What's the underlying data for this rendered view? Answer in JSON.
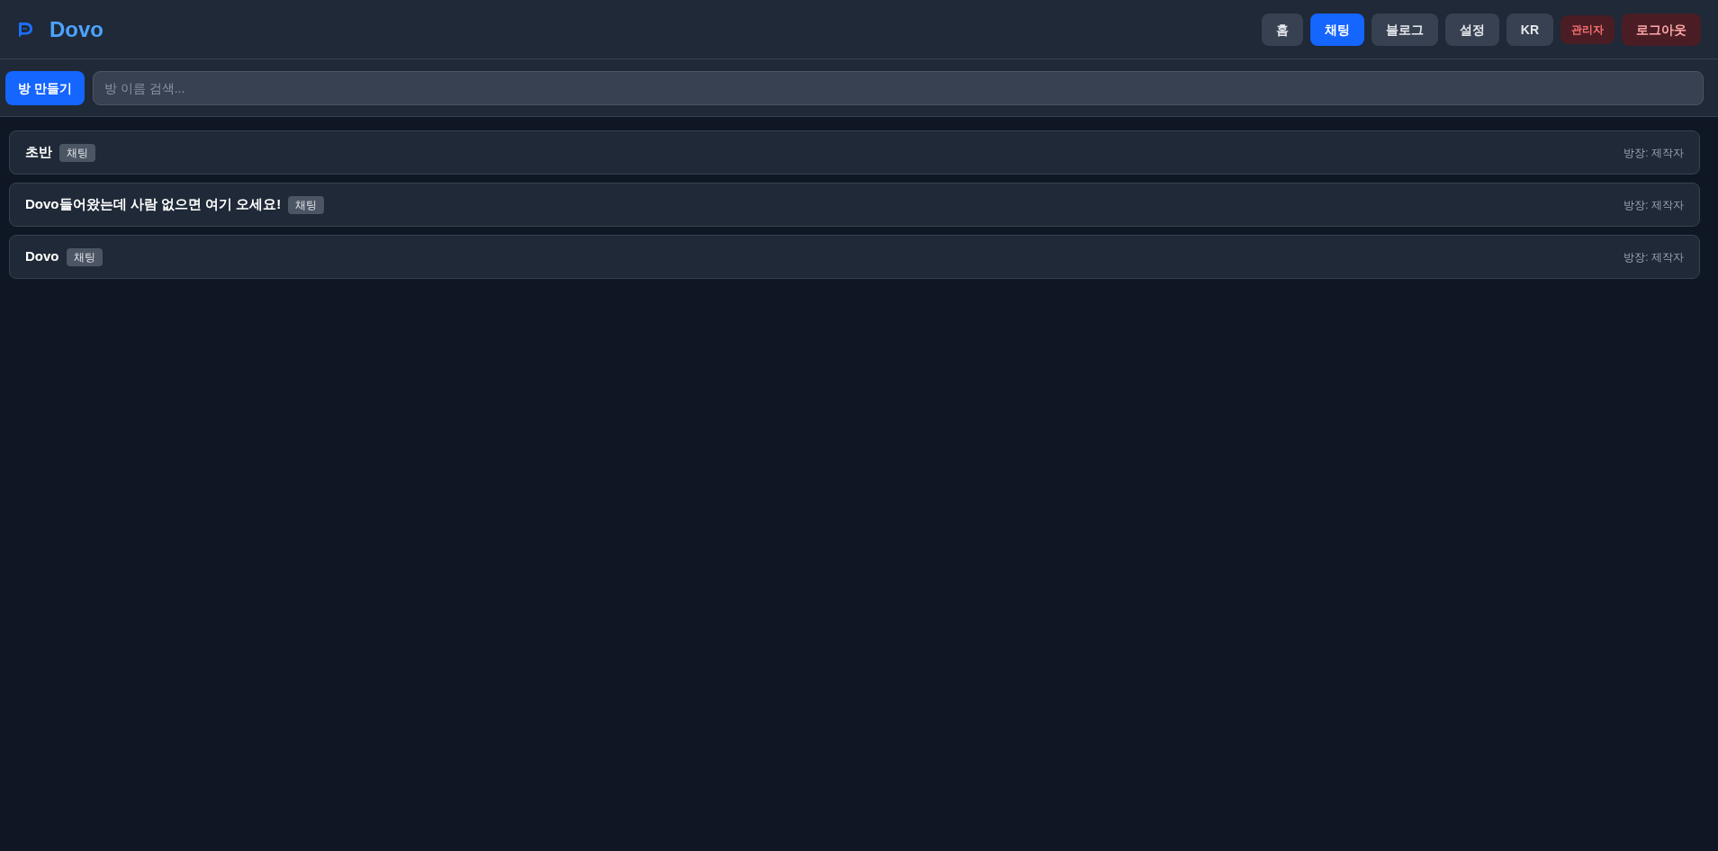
{
  "header": {
    "logo": {
      "text": "Dovo"
    },
    "nav": [
      {
        "label": "홈",
        "kind": "nav",
        "selected": false
      },
      {
        "label": "채팅",
        "kind": "nav",
        "selected": true
      },
      {
        "label": "블로그",
        "kind": "nav",
        "selected": false
      },
      {
        "label": "설정",
        "kind": "nav",
        "selected": false
      },
      {
        "label": "KR",
        "kind": "nav",
        "selected": false
      },
      {
        "label": "관리자",
        "kind": "admin",
        "selected": false
      },
      {
        "label": "로그아웃",
        "kind": "logout",
        "selected": false
      }
    ]
  },
  "toolbar": {
    "create_button": "방 만들기",
    "search": {
      "placeholder": "방 이름 검색..."
    }
  },
  "rooms": [
    {
      "name": "초반",
      "tag": "채팅",
      "owner": "방장: 제작자"
    },
    {
      "name": "Dovo들어왔는데 사람 없으면 여기 오세요!",
      "tag": "채팅",
      "owner": "방장: 제작자"
    },
    {
      "name": "Dovo",
      "tag": "채팅",
      "owner": "방장: 제작자"
    }
  ]
}
